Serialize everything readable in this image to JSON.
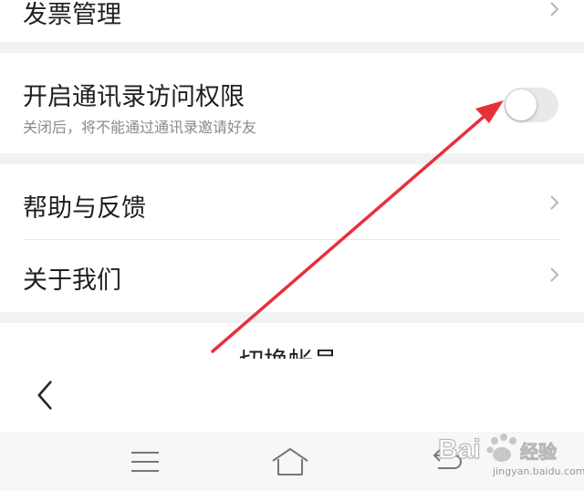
{
  "settings": {
    "invoice_label": "发票管理",
    "contacts_permission": {
      "label": "开启通讯录访问权限",
      "description": "关闭后，将不能通过通讯录邀请好友",
      "enabled": false
    },
    "help_label": "帮助与反馈",
    "about_label": "关于我们",
    "switch_account_label": "切换帐号"
  },
  "watermark": {
    "brand": "Bai",
    "product": "经验",
    "url": "jingyan.baidu.com"
  },
  "colors": {
    "annotation_arrow": "#e8303a",
    "toggle_off": "#e9e9e9"
  }
}
